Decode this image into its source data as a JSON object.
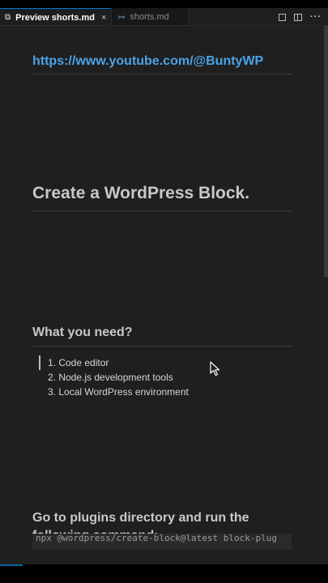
{
  "tabs": [
    {
      "label": "Preview shorts.md",
      "icon": "preview-icon",
      "active": true,
      "close": "×"
    },
    {
      "label": "shorts.md",
      "icon": "markdown-icon",
      "active": false
    }
  ],
  "actions": {
    "more": "···"
  },
  "preview": {
    "link": "https://www.youtube.com/@BuntyWP",
    "heading1": "Create a WordPress Block.",
    "section1": {
      "heading": "What you need?",
      "items": [
        "1. Code editor",
        "2. Node.js development tools",
        "3. Local WordPress environment"
      ]
    },
    "section2": {
      "heading_line1": "Go to plugins directory and run the",
      "heading_line2": "following command:",
      "code": "npx @wordpress/create-block@latest block-plug"
    }
  },
  "colors": {
    "background": "#1f1f1f",
    "link": "#4aa3e8",
    "heading": "#c8c8c8",
    "tab_accent": "#0078d4"
  }
}
